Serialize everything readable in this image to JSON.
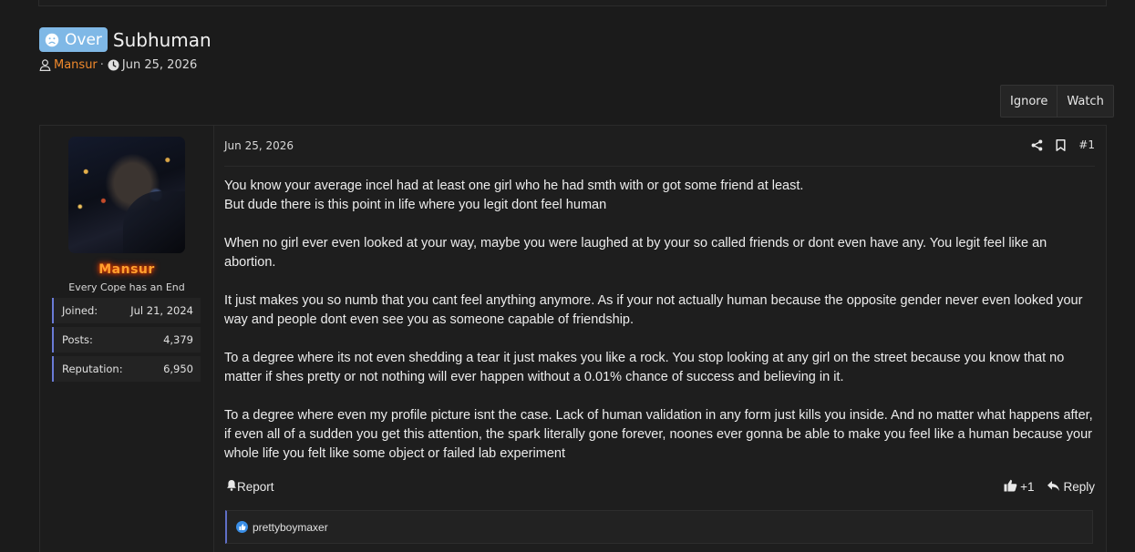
{
  "thread": {
    "prefix_label": "Over",
    "title": "Subhuman",
    "author": "Mansur",
    "separator": "·",
    "date": "Jun 25, 2026",
    "buttons": {
      "ignore": "Ignore",
      "watch": "Watch"
    }
  },
  "post": {
    "user": {
      "name": "Mansur",
      "user_title": "Every Cope has an End",
      "stats": [
        {
          "label": "Joined:",
          "value": "Jul 21, 2024"
        },
        {
          "label": "Posts:",
          "value": "4,379"
        },
        {
          "label": "Reputation:",
          "value": "6,950"
        }
      ]
    },
    "date": "Jun 25, 2026",
    "number": "#1",
    "paragraphs": [
      "You know your average incel had at least one girl who he had smth with or got some friend at least.",
      "But dude there is this point in life where you legit dont feel human",
      "When no girl ever even looked at your way, maybe you were laughed at by your so called friends or dont even have any. You legit feel like an abortion.",
      "It just makes you so numb that you cant feel anything anymore. As if your not actually human because the opposite gender never even looked your way and people dont even see you as someone capable of friendship.",
      "To a degree where its not even shedding a tear it just makes you like a rock. You stop looking at any girl on the street because you know that no matter if shes pretty or not nothing will ever happen without a 0.01% chance of success and believing in it.",
      "To a degree where even my profile picture isnt the case. Lack of human validation in any form just kills you inside. And no matter what happens after, if even all of a sudden you get this attention, the spark literally gone forever, noones ever gonna be able to make you feel like a human because your whole life you felt like some object or failed lab experiment"
    ],
    "footer": {
      "report": "Report",
      "reaction_count": "+1",
      "reply": "Reply"
    },
    "reactions": {
      "users": "prettyboymaxer"
    }
  },
  "colors": {
    "background": "#1b1b1b",
    "prefix_badge": "#7fb8e6",
    "username_accent": "#f0892c",
    "stat_border": "#6a7bd6",
    "like_blue": "#3a8ee6"
  }
}
